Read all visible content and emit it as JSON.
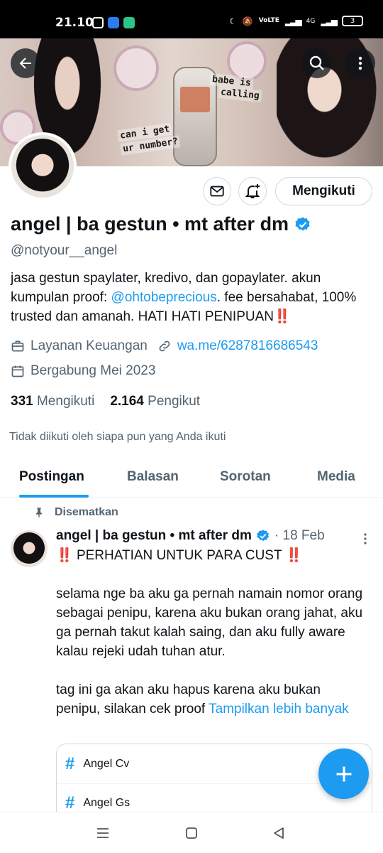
{
  "status_bar": {
    "time": "21.10",
    "battery": "3",
    "network_label": "4G"
  },
  "banner": {
    "text_line1": "babe is",
    "text_line2": "calling",
    "text_line3": "can i get",
    "text_line4": "ur number?"
  },
  "header": {
    "back_icon": "arrow-left-icon",
    "search_icon": "search-icon",
    "more_icon": "more-vertical-icon"
  },
  "actions": {
    "message_icon": "mail-icon",
    "notify_icon": "bell-plus-icon",
    "follow_label": "Mengikuti"
  },
  "profile": {
    "display_name": "angel | ba gestun • mt after dm",
    "handle": "@notyour__angel",
    "bio_part1": "jasa gestun spaylater, kredivo, dan gopaylater. akun kumpulan proof: ",
    "bio_link": "@ohtobeprecious",
    "bio_part2": ". fee bersahabat, 100% trusted dan amanah. HATI HATI PENIPUAN",
    "bio_emoji": "‼️",
    "category": "Layanan Keuangan",
    "website": "wa.me/6287816686543",
    "joined": "Bergabung Mei 2023",
    "following_count": "331",
    "following_label": "Mengikuti",
    "followers_count": "2.164",
    "followers_label": "Pengikut",
    "not_followed_note": "Tidak diikuti oleh siapa pun yang Anda ikuti"
  },
  "tabs": [
    {
      "label": "Postingan"
    },
    {
      "label": "Balasan"
    },
    {
      "label": "Sorotan"
    },
    {
      "label": "Media"
    }
  ],
  "pinned_post": {
    "pinned_label": "Disematkan",
    "author": "angel | ba gestun • mt after dm",
    "date": "· 18 Feb",
    "headline_emoji": "‼️",
    "headline": "PERHATIAN UNTUK PARA CUST",
    "paragraph1": "selama nge ba aku ga pernah namain nomor orang sebagai penipu, karena aku bukan orang jahat, aku ga pernah takut kalah saing, dan aku fully aware kalau rejeki udah tuhan atur.",
    "paragraph2": "tag ini ga akan aku hapus karena aku bukan penipu, silakan cek proof ",
    "show_more": "Tampilkan lebih banyak",
    "hashtags": [
      {
        "label": "Angel Cv"
      },
      {
        "label": "Angel Gs"
      }
    ]
  },
  "fab": {
    "icon": "plus-icon"
  },
  "colors": {
    "accent": "#1d9bf0",
    "text_primary": "#0f1419",
    "text_secondary": "#536471",
    "border": "#cfd9de"
  }
}
